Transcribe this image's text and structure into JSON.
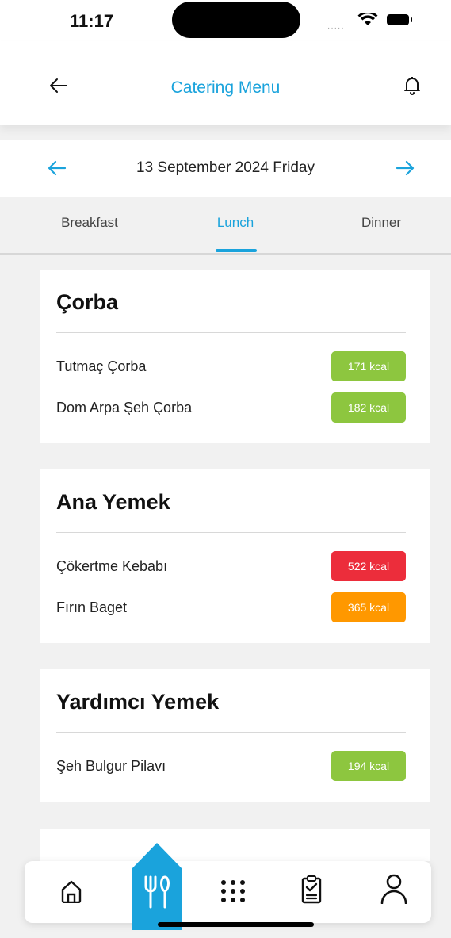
{
  "status_bar": {
    "time": "11:17"
  },
  "header": {
    "title": "Catering Menu"
  },
  "date_nav": {
    "date": "13 September 2024 Friday"
  },
  "tabs": [
    {
      "label": "Breakfast",
      "active": false
    },
    {
      "label": "Lunch",
      "active": true
    },
    {
      "label": "Dinner",
      "active": false
    }
  ],
  "sections": [
    {
      "title": "Çorba",
      "items": [
        {
          "name": "Tutmaç Çorba",
          "kcal": "171 kcal",
          "color": "#8dc63f"
        },
        {
          "name": "Dom Arpa Şeh Çorba",
          "kcal": "182 kcal",
          "color": "#8dc63f"
        }
      ]
    },
    {
      "title": "Ana Yemek",
      "items": [
        {
          "name": "Çökertme Kebabı",
          "kcal": "522 kcal",
          "color": "#ec2d3b"
        },
        {
          "name": "Fırın Baget",
          "kcal": "365 kcal",
          "color": "#ff9800"
        }
      ]
    },
    {
      "title": "Yardımcı Yemek",
      "items": [
        {
          "name": "Şeh Bulgur Pilavı",
          "kcal": "194 kcal",
          "color": "#8dc63f"
        }
      ]
    }
  ],
  "bottom_nav": [
    {
      "icon": "home-icon",
      "active": false
    },
    {
      "icon": "fork-knife-icon",
      "active": true
    },
    {
      "icon": "grid-dots-icon",
      "active": false
    },
    {
      "icon": "checklist-icon",
      "active": false
    },
    {
      "icon": "user-icon",
      "active": false
    }
  ],
  "colors": {
    "accent": "#1aa3dc",
    "green": "#8dc63f",
    "red": "#ec2d3b",
    "orange": "#ff9800"
  }
}
